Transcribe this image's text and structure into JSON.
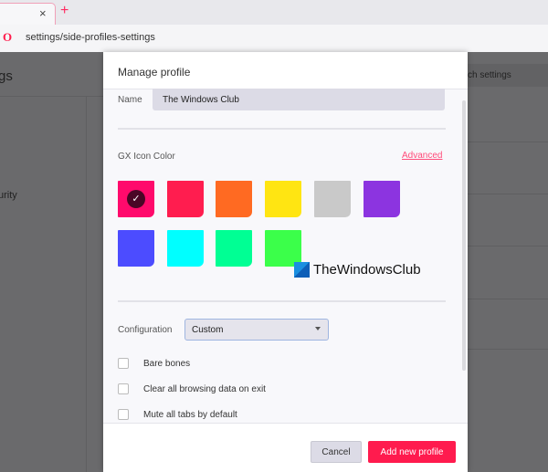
{
  "browser": {
    "new_tab_icon": "plus-icon",
    "close_tab_icon": "close-icon",
    "close_glyph": "×",
    "plus_glyph": "+",
    "logo": "opera-logo",
    "url": "settings/side-profiles-settings"
  },
  "background": {
    "title_fragment": "gs",
    "security_fragment": "urity",
    "search_fragment": "ch settings"
  },
  "modal": {
    "title": "Manage profile",
    "name_label": "Name",
    "name_value": "The Windows Club",
    "gx_label": "GX Icon Color",
    "advanced_link": "Advanced",
    "selected_color_index": 0,
    "colors": [
      "#ff0a6c",
      "#ff1d4f",
      "#ff6a22",
      "#ffe512",
      "#c9c9c9",
      "#8c34e0",
      "#4c4cff",
      "#00ffff",
      "#00ff94",
      "#3bff4a"
    ],
    "configuration_label": "Configuration",
    "configuration_value": "Custom",
    "options": [
      {
        "label": "Bare bones",
        "checked": false
      },
      {
        "label": "Clear all browsing data on exit",
        "checked": false
      },
      {
        "label": "Mute all tabs by default",
        "checked": false
      }
    ],
    "cancel_label": "Cancel",
    "add_label": "Add new profile"
  },
  "watermark": "TheWindowsClub",
  "accent": "#ff1b4e"
}
